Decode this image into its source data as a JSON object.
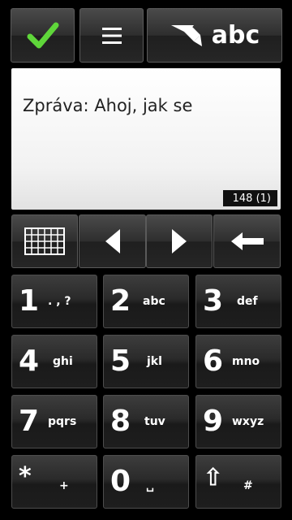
{
  "toolbar": {
    "confirm_icon": "checkmark-icon",
    "menu_icon": "menu-icon",
    "input_mode_label": "abc",
    "input_mode_icon": "pencil-icon"
  },
  "editor": {
    "message_text": "Zpráva: Ahoj, jak se",
    "char_counter": "148 (1)"
  },
  "controls": {
    "keyboard_icon": "keyboard-icon",
    "left_icon": "arrow-left-icon",
    "right_icon": "arrow-right-icon",
    "backspace_icon": "backspace-icon"
  },
  "keypad": [
    {
      "digit": "1",
      "letters": ". , ?"
    },
    {
      "digit": "2",
      "letters": "abc"
    },
    {
      "digit": "3",
      "letters": "def"
    },
    {
      "digit": "4",
      "letters": "ghi"
    },
    {
      "digit": "5",
      "letters": "jkl"
    },
    {
      "digit": "6",
      "letters": "mno"
    },
    {
      "digit": "7",
      "letters": "pqrs"
    },
    {
      "digit": "8",
      "letters": "tuv"
    },
    {
      "digit": "9",
      "letters": "wxyz"
    },
    {
      "digit": "*",
      "letters": "+"
    },
    {
      "digit": "0",
      "letters": "␣"
    },
    {
      "digit": "⇧",
      "letters": "#"
    }
  ],
  "colors": {
    "accent_check": "#3fbf1f",
    "background": "#000000"
  }
}
